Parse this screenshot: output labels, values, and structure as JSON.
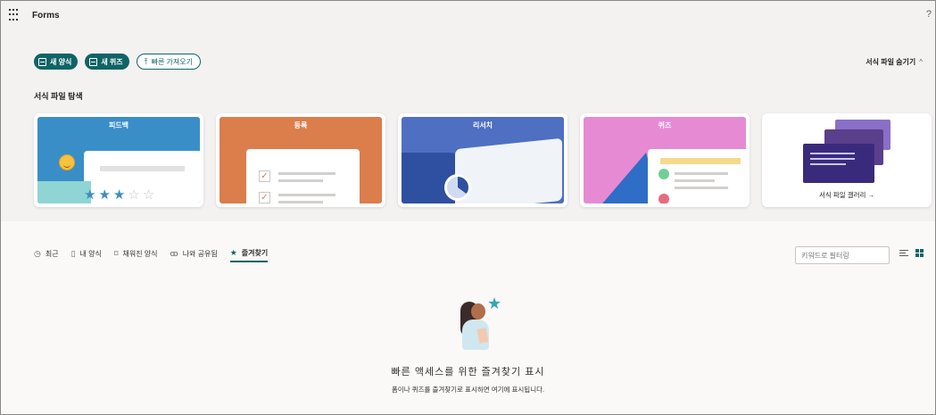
{
  "header": {
    "app_title": "Forms",
    "help_label": "?"
  },
  "actions": {
    "new_form": "새 양식",
    "new_quiz": "새 퀴즈",
    "quick_import": "빠른 가져오기"
  },
  "templates": {
    "hide_label": "서식 파일 숨기기",
    "section_title": "서식 파일 탐색",
    "cards": [
      {
        "label": "피드백"
      },
      {
        "label": "등록"
      },
      {
        "label": "리서치"
      },
      {
        "label": "퀴즈"
      }
    ],
    "gallery_label": "서식 파일 갤러리 →"
  },
  "tabs": [
    {
      "label": "최근",
      "icon": "clock-icon"
    },
    {
      "label": "내 양식",
      "icon": "document-icon"
    },
    {
      "label": "채워진 양식",
      "icon": "bookmark-icon"
    },
    {
      "label": "나와 공유됨",
      "icon": "people-icon"
    },
    {
      "label": "즐겨찾기",
      "icon": "star-icon",
      "active": true
    }
  ],
  "filter": {
    "placeholder": "키워드로 필터링"
  },
  "empty_state": {
    "title": "빠른 액세스를 위한 즐겨찾기 표시",
    "subtitle": "폼이나 퀴즈를 즐겨찾기로 표시하면 여기에 표시됩니다."
  },
  "colors": {
    "accent": "#0f6466",
    "feedback": "#3a8ec8",
    "register": "#dc7d4c",
    "research": "#4e6fc2",
    "quiz": "#e68ad4"
  }
}
